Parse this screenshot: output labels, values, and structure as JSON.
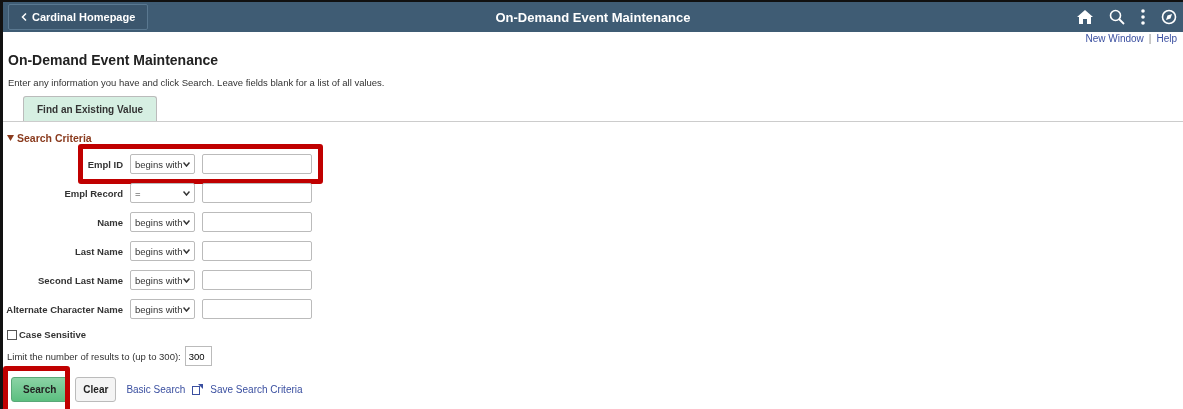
{
  "header": {
    "home_button": "Cardinal Homepage",
    "title": "On-Demand Event Maintenance"
  },
  "links": [
    "New Window",
    "|",
    "Help"
  ],
  "page_title": "On-Demand Event Maintenance",
  "instructions": "Enter any information you have and click Search. Leave fields blank for a list of all values.",
  "tabs": [
    {
      "label": "Find an Existing Value",
      "selected": true
    }
  ],
  "section": {
    "label": "Search Criteria",
    "expanded": true
  },
  "criteria": [
    {
      "label": "Empl ID",
      "operator": "begins with",
      "highlighted": true
    },
    {
      "label": "Empl Record",
      "operator": "=",
      "highlighted": false
    },
    {
      "label": "Name",
      "operator": "begins with",
      "highlighted": false
    },
    {
      "label": "Last Name",
      "operator": "begins with",
      "highlighted": false
    },
    {
      "label": "Second Last Name",
      "operator": "begins with",
      "highlighted": false
    },
    {
      "label": "Alternate Character Name",
      "operator": "begins with",
      "highlighted": false
    }
  ],
  "case_sensitive": {
    "label": "Case Sensitive",
    "checked": false
  },
  "limit": {
    "label": "Limit the number of results to (up to 300):",
    "value": "300"
  },
  "buttons": [
    {
      "label": "Search",
      "kind": "primary",
      "highlighted": true
    },
    {
      "label": "Clear",
      "kind": "secondary",
      "highlighted": false
    }
  ],
  "footer_links": [
    "Basic Search",
    "Save Search Criteria"
  ]
}
